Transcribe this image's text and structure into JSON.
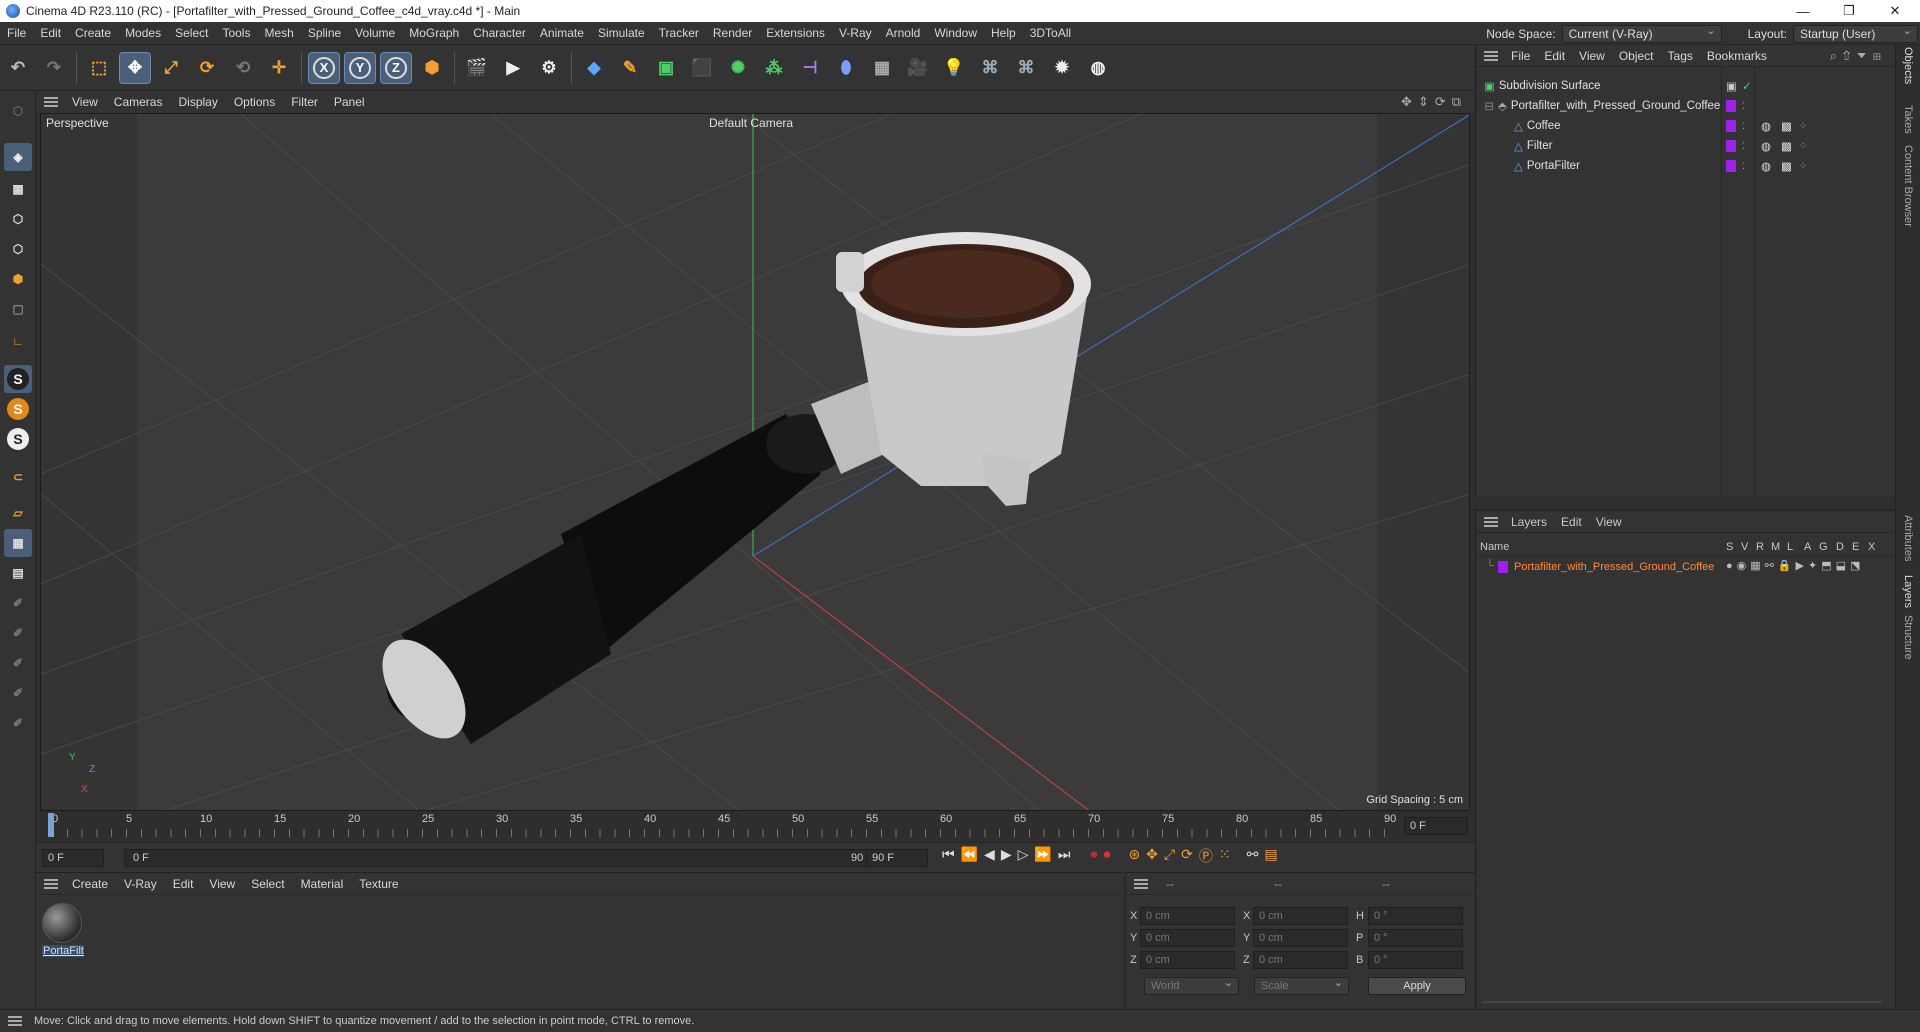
{
  "window": {
    "title": "Cinema 4D R23.110 (RC) - [Portafilter_with_Pressed_Ground_Coffee_c4d_vray.c4d *] - Main",
    "controls": [
      "—",
      "❐",
      "✕"
    ]
  },
  "menubar": {
    "items": [
      "File",
      "Edit",
      "Create",
      "Modes",
      "Select",
      "Tools",
      "Mesh",
      "Spline",
      "Volume",
      "MoGraph",
      "Character",
      "Animate",
      "Simulate",
      "Tracker",
      "Render",
      "Extensions",
      "V-Ray",
      "Arnold",
      "Window",
      "Help",
      "3DToAll"
    ],
    "node_space_label": "Node Space:",
    "node_space_value": "Current (V-Ray)",
    "layout_label": "Layout:",
    "layout_value": "Startup (User)"
  },
  "toolbar": {
    "axis_x": "X",
    "axis_y": "Y",
    "axis_z": "Z"
  },
  "viewport": {
    "menu": [
      "View",
      "Cameras",
      "Display",
      "Options",
      "Filter",
      "Panel"
    ],
    "view_name": "Perspective",
    "camera_label": "Default Camera",
    "grid_spacing": "Grid Spacing : 5 cm",
    "axis_y": "Y",
    "axis_z": "Z",
    "axis_x": "X"
  },
  "timeline": {
    "ticks": [
      "0",
      "5",
      "10",
      "15",
      "20",
      "25",
      "30",
      "35",
      "40",
      "45",
      "50",
      "55",
      "60",
      "65",
      "70",
      "75",
      "80",
      "85",
      "90"
    ],
    "current_frame": "0 F"
  },
  "transport": {
    "start_field": "0 F",
    "range_start": "0 F",
    "range_end": "90 F",
    "end_field": "90 F"
  },
  "material_panel": {
    "menu": [
      "Create",
      "V-Ray",
      "Edit",
      "View",
      "Select",
      "Material",
      "Texture"
    ],
    "material_name": "PortaFilt"
  },
  "coord_panel": {
    "header": [
      "--",
      "--",
      "--"
    ],
    "rows": [
      {
        "a": "X",
        "av": "0 cm",
        "b": "X",
        "bv": "0 cm",
        "c": "H",
        "cv": "0 °"
      },
      {
        "a": "Y",
        "av": "0 cm",
        "b": "Y",
        "bv": "0 cm",
        "c": "P",
        "cv": "0 °"
      },
      {
        "a": "Z",
        "av": "0 cm",
        "b": "Z",
        "bv": "0 cm",
        "c": "B",
        "cv": "0 °"
      }
    ],
    "space": "World",
    "mode": "Scale",
    "apply": "Apply"
  },
  "objects_panel": {
    "menu": [
      "File",
      "Edit",
      "View",
      "Object",
      "Tags",
      "Bookmarks"
    ],
    "items": [
      {
        "name": "Subdivision Surface",
        "level": 0
      },
      {
        "name": "Portafilter_with_Pressed_Ground_Coffee",
        "level": 1
      },
      {
        "name": "Coffee",
        "level": 2
      },
      {
        "name": "Filter",
        "level": 2
      },
      {
        "name": "PortaFilter",
        "level": 2
      }
    ]
  },
  "layers_panel": {
    "menu": [
      "Layers",
      "Edit",
      "View"
    ],
    "col_name": "Name",
    "col_flags": [
      "S",
      "V",
      "R",
      "M",
      "L",
      "A",
      "G",
      "D",
      "E",
      "X"
    ],
    "layer_name": "Portafilter_with_Pressed_Ground_Coffee"
  },
  "right_tabs": [
    "Objects",
    "Takes",
    "Content Browser",
    "Attributes",
    "Layers",
    "Structure"
  ],
  "status": "Move: Click and drag to move elements. Hold down SHIFT to quantize movement / add to the selection in point mode, CTRL to remove.",
  "colors": {
    "layer_purple": "#a020f0",
    "accent_blue": "#4b5f7a",
    "layer_text": "#ff8a3a"
  }
}
